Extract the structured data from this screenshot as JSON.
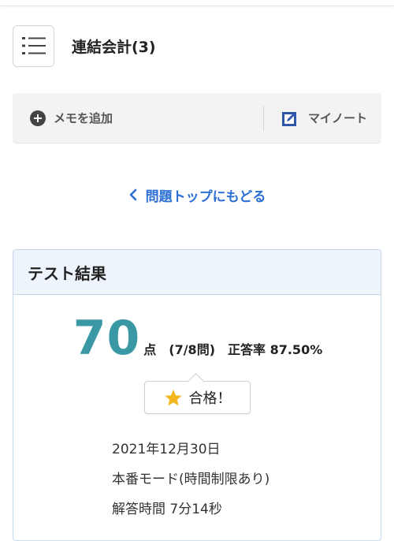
{
  "header": {
    "title": "連結会計(3)",
    "menu_icon": "list-menu-icon"
  },
  "memo_bar": {
    "add_memo_label": "メモを追加",
    "add_icon": "plus-circle-icon",
    "mynote_label": "マイノート",
    "mynote_icon": "edit-note-icon"
  },
  "navigation": {
    "back_label": "問題トップにもどる",
    "back_icon": "chevron-left-icon"
  },
  "result": {
    "heading": "テスト結果",
    "score": "70",
    "score_unit": "点",
    "correct_count": "(7/8問)",
    "accuracy": "正答率 87.50%",
    "pass_label": "合格！",
    "pass_icon": "star-icon",
    "date": "2021年12月30日",
    "mode": "本番モード(時間制限あり)",
    "duration": "解答時間 7分14秒"
  },
  "colors": {
    "accent": "#3a98a4",
    "link": "#2b6fd4",
    "star": "#f2b51c",
    "card_header_bg": "#eef4fb"
  }
}
